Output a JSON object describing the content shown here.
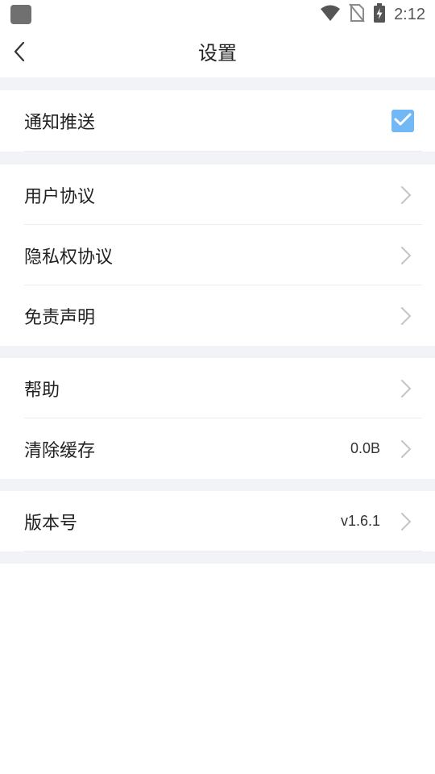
{
  "status_bar": {
    "time": "2:12",
    "icons": [
      "app-placeholder-icon",
      "wifi-icon",
      "no-sim-icon",
      "battery-charging-icon"
    ]
  },
  "header": {
    "title": "设置",
    "back_icon": "chevron-left-icon"
  },
  "sections": [
    {
      "rows": [
        {
          "label": "通知推送",
          "control": "checkbox",
          "checked": true
        }
      ]
    },
    {
      "rows": [
        {
          "label": "用户协议",
          "control": "chevron"
        },
        {
          "label": "隐私权协议",
          "control": "chevron"
        },
        {
          "label": "免责声明",
          "control": "chevron"
        }
      ]
    },
    {
      "rows": [
        {
          "label": "帮助",
          "control": "chevron"
        },
        {
          "label": "清除缓存",
          "value": "0.0B",
          "control": "chevron"
        }
      ]
    },
    {
      "rows": [
        {
          "label": "版本号",
          "value": "v1.6.1",
          "control": "chevron"
        }
      ]
    }
  ],
  "colors": {
    "background": "#ffffff",
    "section_gap": "#f2f3f7",
    "divider": "#ececec",
    "checkbox_accent": "#72b7f6",
    "chevron": "#c4c4c4",
    "text": "#222222"
  }
}
